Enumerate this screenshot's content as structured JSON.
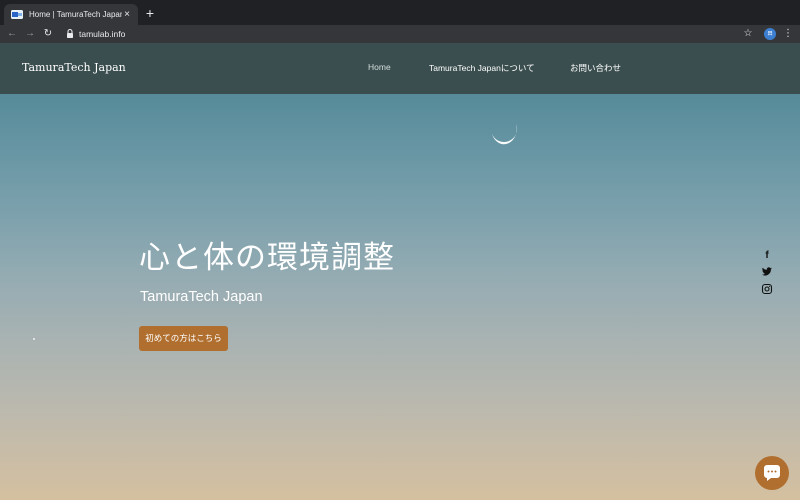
{
  "browser": {
    "tab": {
      "title": "Home | TamuraTech Japan",
      "close": "×"
    },
    "new_tab": "+",
    "nav": {
      "back": "←",
      "forward": "→",
      "reload": "↻"
    },
    "address": "tamulab.info",
    "star": "☆",
    "profile": "田",
    "menu": "⋮"
  },
  "site": {
    "logo": "TamuraTech Japan",
    "nav": [
      {
        "label": "Home",
        "active": true
      },
      {
        "label": "TamuraTech Japanについて"
      },
      {
        "label": "お問い合わせ"
      }
    ],
    "hero": {
      "title": "心と体の環境調整",
      "subtitle": "TamuraTech Japan",
      "cta": "初めての方はこちら"
    },
    "social": {
      "facebook": "f",
      "twitter": "🐦",
      "instagram": "◎"
    },
    "colors": {
      "header_bg": "#3b4e4f",
      "accent": "#b06f2f"
    }
  }
}
